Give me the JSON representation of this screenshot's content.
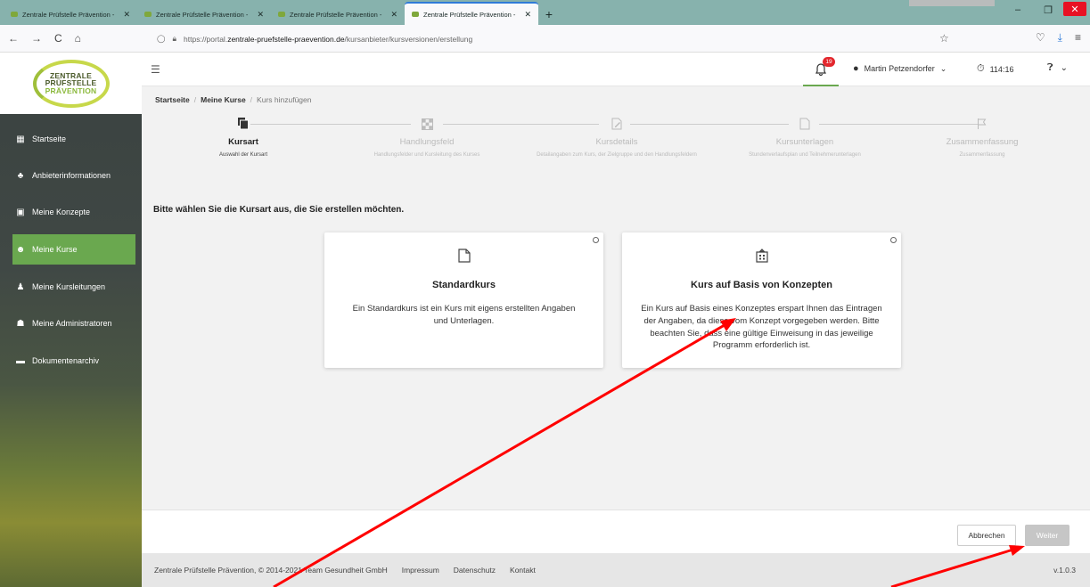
{
  "browser": {
    "tabs": [
      {
        "label": "Zentrale Prüfstelle Prävention -",
        "active": false
      },
      {
        "label": "Zentrale Prüfstelle Prävention -",
        "active": false
      },
      {
        "label": "Zentrale Prüfstelle Prävention -",
        "active": false
      },
      {
        "label": "Zentrale Prüfstelle Prävention -",
        "active": true
      }
    ],
    "url_prefix": "https://portal.",
    "url_domain": "zentrale-pruefstelle-praevention.de",
    "url_path": "/kursanbieter/kursversionen/erstellung"
  },
  "logo": {
    "line1": "ZENTRALE",
    "line2": "PRÜFSTELLE",
    "line3": "PRÄVENTION"
  },
  "sidebar": {
    "items": [
      {
        "label": "Startseite",
        "icon": "dashboard-icon",
        "active": false
      },
      {
        "label": "Anbieterinformationen",
        "icon": "org-chart-icon",
        "active": false
      },
      {
        "label": "Meine Konzepte",
        "icon": "building-icon",
        "active": false
      },
      {
        "label": "Meine Kurse",
        "icon": "group-icon",
        "active": true
      },
      {
        "label": "Meine Kursleitungen",
        "icon": "teacher-icon",
        "active": false
      },
      {
        "label": "Meine Administratoren",
        "icon": "admin-users-icon",
        "active": false
      },
      {
        "label": "Dokumentenarchiv",
        "icon": "folder-icon",
        "active": false
      }
    ]
  },
  "header": {
    "notifications_count": "19",
    "user_name": "Martin Petzendorfer",
    "timer": "114:16"
  },
  "breadcrumb": {
    "home": "Startseite",
    "courses": "Meine Kurse",
    "current": "Kurs hinzufügen"
  },
  "steps": [
    {
      "title": "Kursart",
      "subtitle": "Auswahl der Kursart",
      "active": true,
      "icon": "layers-icon"
    },
    {
      "title": "Handlungsfeld",
      "subtitle": "Handlungsfelder und Kursleitung des Kurses",
      "active": false,
      "icon": "checkerboard-icon"
    },
    {
      "title": "Kursdetails",
      "subtitle": "Detailangaben zum Kurs, der Zielgruppe und den Handlungsfeldern",
      "active": false,
      "icon": "edit-document-icon"
    },
    {
      "title": "Kursunterlagen",
      "subtitle": "Stundenverlaufsplan und Teilnehmerunterlagen",
      "active": false,
      "icon": "document-icon"
    },
    {
      "title": "Zusammenfassung",
      "subtitle": "Zusammenfassung",
      "active": false,
      "icon": "flag-icon"
    }
  ],
  "main": {
    "prompt": "Bitte wählen Sie die Kursart aus, die Sie erstellen möchten.",
    "cards": [
      {
        "title": "Standardkurs",
        "description": "Ein Standardkurs ist ein Kurs mit eigens erstellten Angaben und Unterlagen."
      },
      {
        "title": "Kurs auf Basis von Konzepten",
        "description": "Ein Kurs auf Basis eines Konzeptes erspart Ihnen das Eintragen der Angaben, da diese vom Konzept vorgegeben werden. Bitte beachten Sie, dass eine gültige Einweisung in das jeweilige Programm erforderlich ist."
      }
    ],
    "cancel_label": "Abbrechen",
    "next_label": "Weiter"
  },
  "footer": {
    "copyright": "Zentrale Prüfstelle Prävention, © 2014-2021 Team Gesundheit GmbH",
    "links": [
      "Impressum",
      "Datenschutz",
      "Kontakt"
    ],
    "version": "v.1.0.3"
  },
  "colors": {
    "accent_green": "#6aa84f",
    "badge_red": "#e3272d",
    "annotation_red": "#ff0000"
  }
}
